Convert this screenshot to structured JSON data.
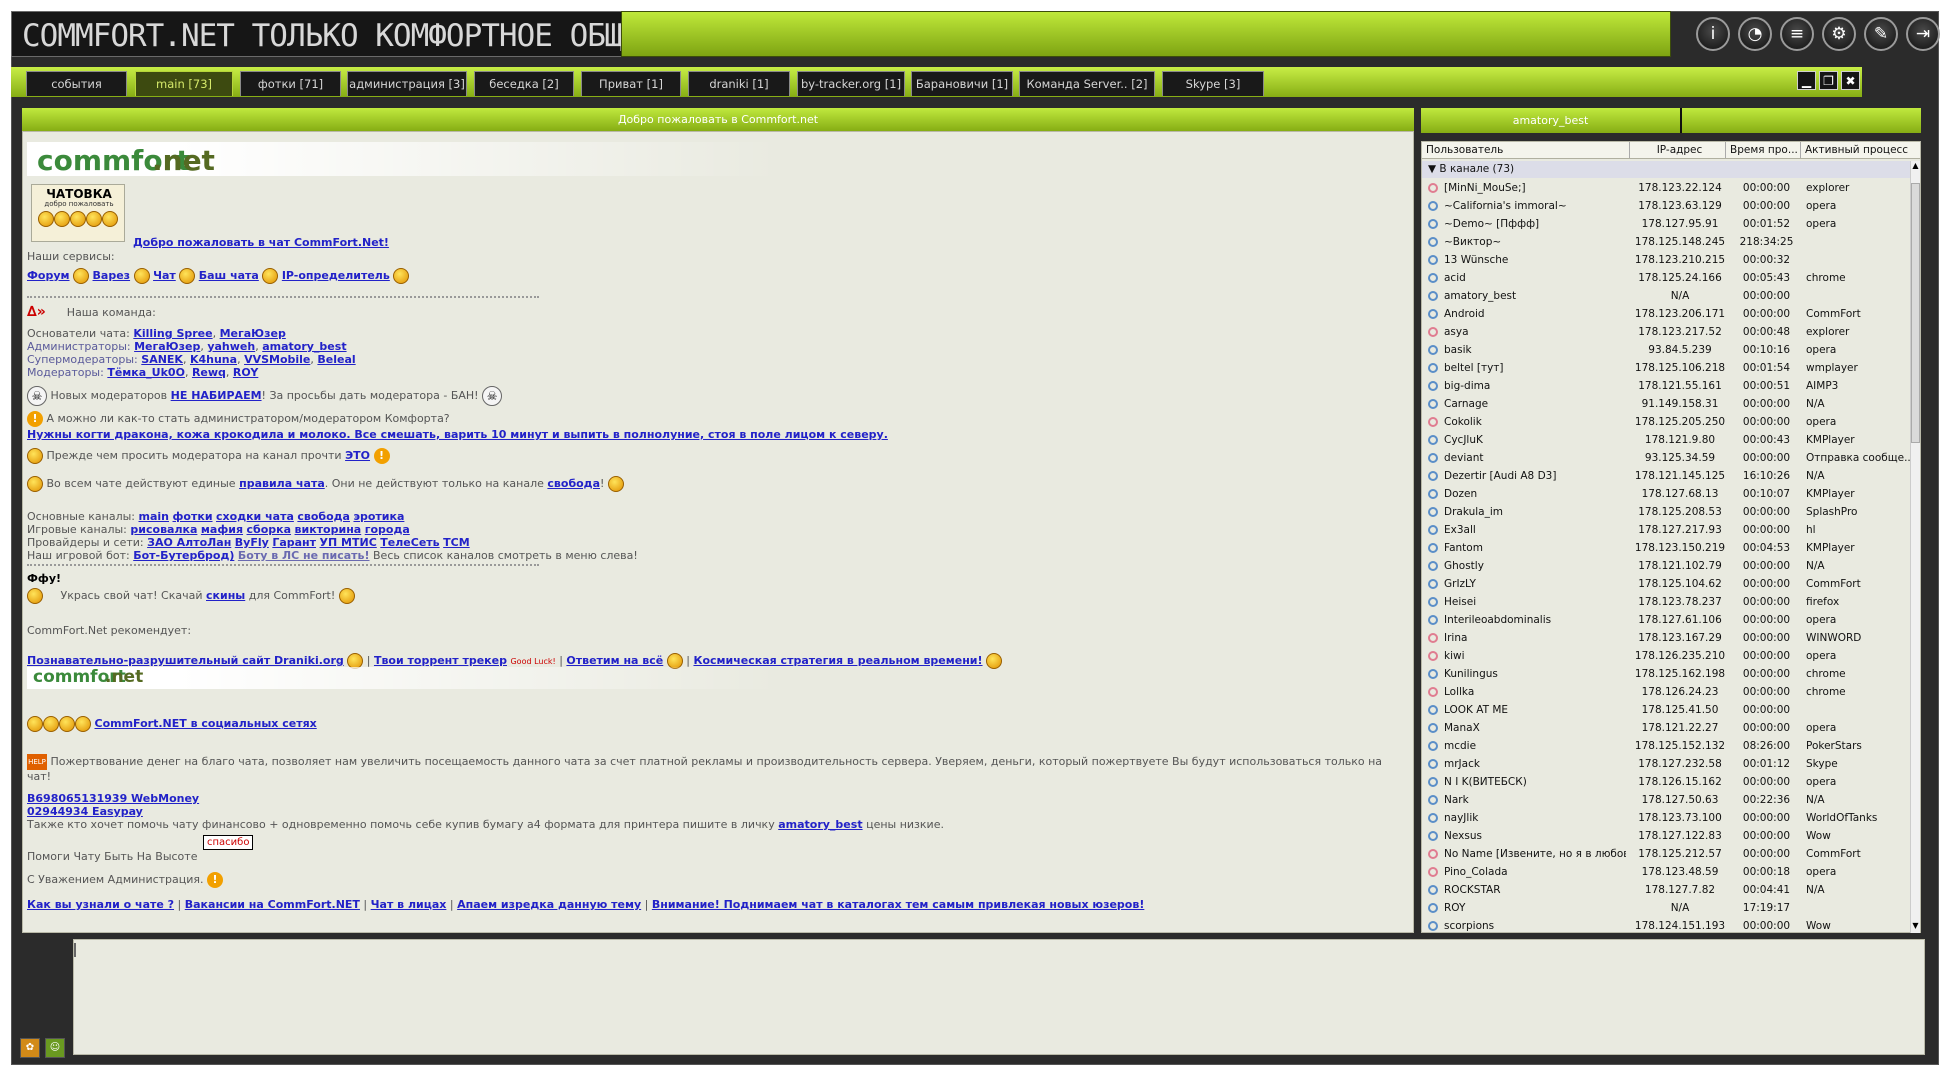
{
  "banner": {
    "title": "COMMFORT.NET ТОЛЬКО КОМФОРТНОЕ ОБЩЕНИЕ"
  },
  "top_icons": [
    {
      "name": "info-icon",
      "glyph": "i"
    },
    {
      "name": "chat-bubble-icon",
      "glyph": "◔"
    },
    {
      "name": "list-icon",
      "glyph": "≡"
    },
    {
      "name": "gear-icon",
      "glyph": "⚙"
    },
    {
      "name": "edit-icon",
      "glyph": "✎"
    },
    {
      "name": "exit-icon",
      "glyph": "⇥"
    }
  ],
  "tabs": [
    {
      "label": "события",
      "active": false
    },
    {
      "label": "main [73]",
      "active": true
    },
    {
      "label": "фотки [71]",
      "active": false
    },
    {
      "label": "администрация [3]",
      "active": false
    },
    {
      "label": "беседка [2]",
      "active": false
    },
    {
      "label": "Приват [1]",
      "active": false
    },
    {
      "label": "draniki [1]",
      "active": false
    },
    {
      "label": "by-tracker.org [1]",
      "active": false
    },
    {
      "label": "Барановичи [1]",
      "active": false
    },
    {
      "label": "Команда Server.. [2]",
      "active": false
    },
    {
      "label": "Skype [3]",
      "active": false
    }
  ],
  "window_buttons": {
    "minimize": "▁",
    "restore": "❐",
    "close": "✖"
  },
  "chat": {
    "header": "Добро пожаловать в Commfort.net",
    "logo_left": "commfort",
    "logo_right": ".net",
    "chatovka": {
      "title": "ЧАТОВКА",
      "subtitle": "добро пожаловать"
    },
    "welcome_link": "Добро пожаловать в чат CommFort.Net!",
    "services_label": "Наши сервисы:",
    "services": [
      "Форум",
      "Варез",
      "Чат",
      "Баш чата",
      "IP-определитель"
    ],
    "team_label": "Наша команда:",
    "founders_label": "Основатели чата:",
    "founders": [
      "Killing Spree",
      "МегаЮзер"
    ],
    "admins_label": "Администраторы:",
    "admins": [
      "МегаЮзер",
      "yahweh",
      "amatory_best"
    ],
    "supermods_label": "Супермодераторы:",
    "supermods": [
      "SANEK",
      "K4huna",
      "VVSMobile",
      "Beleal"
    ],
    "mods_label": "Модераторы:",
    "mods": [
      "Тёмка_Uk0O",
      "Rewq",
      "ROY"
    ],
    "new_mods_pre": "Новых модераторов",
    "new_mods_link": "НЕ НАБИРАЕМ",
    "new_mods_post": "! За просьбы дать модератора - БАН!",
    "admin_q": "А можно ли как-то стать администратором/модератором Комфорта?",
    "admin_a": "Нужны когти дракона, кожа крокодила и молоко. Все смешать, варить 10 минут и выпить в полнолуние, стоя в поле лицом к северу.",
    "before_ask_pre": "Прежде чем просить модератора на канал прочти",
    "before_ask_link": "ЭТО",
    "rules_pre": "Во всем чате действуют единые",
    "rules_link": "правила чата",
    "rules_mid": ". Они не действуют только на канале",
    "rules_link2": "свобода",
    "rules_post": "!",
    "main_channels_label": "Основные каналы:",
    "main_channels": [
      "main",
      "фотки",
      "сходки чата",
      "свобода",
      "эротика"
    ],
    "game_channels_label": "Игровые каналы:",
    "game_channels": [
      "рисовалка",
      "мафия",
      "сборка",
      "викторина",
      "города"
    ],
    "providers_label": "Провайдеры и сети:",
    "providers": [
      "ЗАО АлтоЛан",
      "ByFly",
      "Гарант",
      "УП МТИС",
      "ТелеСеть",
      "TCM"
    ],
    "bot_pre": "Наш игровой бот:",
    "bot_link": "Бот-Бутерброд)",
    "bot_link2": "Боту в ЛС не писать!",
    "bot_post": "Весь список каналов смотреть в меню слева!",
    "fufu": "Ффу!",
    "skins_pre": "Укрась свой чат! Скачай",
    "skins_link": "скины",
    "skins_post": "для CommFort!",
    "recommends": "CommFort.Net рекомендует:",
    "rec_links": [
      "Познавательно-разрушительный сайт Draniki.org",
      "Твои торрент трекер",
      "Ответим на всё",
      "Космическая стратегия в реальном времени!"
    ],
    "good_luck": "Good Luck!",
    "social_link": "CommFort.NET в социальных сетях",
    "help_badge": "HELP",
    "donate_text": "Пожертвование денег на благо чата, позволяет нам увеличить посещаемость данного чата за счет платной рекламы и производительность сервера. Уверяем, деньги, который пожертвуете Вы будут использоваться только на чат!",
    "webmoney": "B698065131939 WebMoney",
    "easypay": "02944934 Easypay",
    "a4_pre": "Также кто хочет помочь чату финансово + одновременно помочь себе купив бумагу а4 формата для принтера пишите в личку",
    "a4_link": "amatory_best",
    "a4_post": "цены низкие.",
    "help_chat": "Помоги Чату Быть На Высоте",
    "thanks_sign": "спасибо",
    "regards": "С Уважением Администрация.",
    "bottom_links": [
      "Как вы узнали о чате ?",
      "Вакансии на CommFort.NET",
      "Чат в лицах",
      "Апаем изредка данную тему",
      "Внимание! Поднимаем чат в каталогах тем самым привлекая новых юзеров!"
    ]
  },
  "userlist": {
    "header": "amatory_best",
    "columns": [
      "Пользователь",
      "IP-адрес",
      "Время про...",
      "Активный процесс"
    ],
    "group": "В канале (73)",
    "rows": [
      {
        "name": "[MinNi_MouSe;]",
        "ip": "178.123.22.124",
        "time": "00:00:00",
        "proc": "explorer",
        "g": "f"
      },
      {
        "name": "~California's immoral~",
        "ip": "178.123.63.129",
        "time": "00:00:00",
        "proc": "opera",
        "g": "m"
      },
      {
        "name": "~Demo~ [Пффф]",
        "ip": "178.127.95.91",
        "time": "00:01:52",
        "proc": "opera",
        "g": "m"
      },
      {
        "name": "~Виктор~",
        "ip": "178.125.148.245",
        "time": "218:34:25",
        "proc": "",
        "g": "m"
      },
      {
        "name": "13 Wünsche",
        "ip": "178.123.210.215",
        "time": "00:00:32",
        "proc": "",
        "g": "m"
      },
      {
        "name": "acid",
        "ip": "178.125.24.166",
        "time": "00:05:43",
        "proc": "chrome",
        "g": "m"
      },
      {
        "name": "amatory_best",
        "ip": "N/A",
        "time": "00:00:00",
        "proc": "",
        "g": "m"
      },
      {
        "name": "Android",
        "ip": "178.123.206.171",
        "time": "00:00:00",
        "proc": "CommFort",
        "g": "m"
      },
      {
        "name": "asya",
        "ip": "178.123.217.52",
        "time": "00:00:48",
        "proc": "explorer",
        "g": "f"
      },
      {
        "name": "basik",
        "ip": "93.84.5.239",
        "time": "00:10:16",
        "proc": "opera",
        "g": "m"
      },
      {
        "name": "beltel [тут]",
        "ip": "178.125.106.218",
        "time": "00:01:54",
        "proc": "wmplayer",
        "g": "m"
      },
      {
        "name": "big-dima",
        "ip": "178.121.55.161",
        "time": "00:00:51",
        "proc": "AIMP3",
        "g": "m"
      },
      {
        "name": "Carnage",
        "ip": "91.149.158.31",
        "time": "00:00:00",
        "proc": "N/A",
        "g": "m"
      },
      {
        "name": "Cokolik",
        "ip": "178.125.205.250",
        "time": "00:00:00",
        "proc": "opera",
        "g": "f"
      },
      {
        "name": "CycJluK",
        "ip": "178.121.9.80",
        "time": "00:00:43",
        "proc": "KMPlayer",
        "g": "m"
      },
      {
        "name": "deviant",
        "ip": "93.125.34.59",
        "time": "00:00:00",
        "proc": "Отправка сообще...",
        "g": "m"
      },
      {
        "name": "Dezertir [Audi A8 D3]",
        "ip": "178.121.145.125",
        "time": "16:10:26",
        "proc": "N/A",
        "g": "m"
      },
      {
        "name": "Dozen",
        "ip": "178.127.68.13",
        "time": "00:10:07",
        "proc": "KMPlayer",
        "g": "m"
      },
      {
        "name": "Drakula_im",
        "ip": "178.125.208.53",
        "time": "00:00:00",
        "proc": "SplashPro",
        "g": "m"
      },
      {
        "name": "Ex3all",
        "ip": "178.127.217.93",
        "time": "00:00:00",
        "proc": "hl",
        "g": "m"
      },
      {
        "name": "Fantom",
        "ip": "178.123.150.219",
        "time": "00:04:53",
        "proc": "KMPlayer",
        "g": "m"
      },
      {
        "name": "Ghostly",
        "ip": "178.121.102.79",
        "time": "00:00:00",
        "proc": "N/A",
        "g": "m"
      },
      {
        "name": "GrIzLY",
        "ip": "178.125.104.62",
        "time": "00:00:00",
        "proc": "CommFort",
        "g": "m"
      },
      {
        "name": "Heisei",
        "ip": "178.123.78.237",
        "time": "00:00:00",
        "proc": "firefox",
        "g": "m"
      },
      {
        "name": "Interileoabdominalis",
        "ip": "178.127.61.106",
        "time": "00:00:00",
        "proc": "opera",
        "g": "m"
      },
      {
        "name": "Irina",
        "ip": "178.123.167.29",
        "time": "00:00:00",
        "proc": "WINWORD",
        "g": "f"
      },
      {
        "name": "kiwi",
        "ip": "178.126.235.210",
        "time": "00:00:00",
        "proc": "opera",
        "g": "f"
      },
      {
        "name": "Kunilingus",
        "ip": "178.125.162.198",
        "time": "00:00:00",
        "proc": "chrome",
        "g": "m"
      },
      {
        "name": "Lollka",
        "ip": "178.126.24.23",
        "time": "00:00:00",
        "proc": "chrome",
        "g": "f"
      },
      {
        "name": "LOOK AT ME",
        "ip": "178.125.41.50",
        "time": "00:00:00",
        "proc": "",
        "g": "m"
      },
      {
        "name": "ManaX",
        "ip": "178.121.22.27",
        "time": "00:00:00",
        "proc": "opera",
        "g": "m"
      },
      {
        "name": "mcdie",
        "ip": "178.125.152.132",
        "time": "08:26:00",
        "proc": "PokerStars",
        "g": "m"
      },
      {
        "name": "mrJack",
        "ip": "178.127.232.58",
        "time": "00:01:12",
        "proc": "Skype",
        "g": "m"
      },
      {
        "name": "N I K(ВИТЕБСК)",
        "ip": "178.126.15.162",
        "time": "00:00:00",
        "proc": "opera",
        "g": "m"
      },
      {
        "name": "Nark",
        "ip": "178.127.50.63",
        "time": "00:22:36",
        "proc": "N/A",
        "g": "m"
      },
      {
        "name": "nayJlik",
        "ip": "178.123.73.100",
        "time": "00:00:00",
        "proc": "WorldOfTanks",
        "g": "m"
      },
      {
        "name": "Nexsus",
        "ip": "178.127.122.83",
        "time": "00:00:00",
        "proc": "Wow",
        "g": "m"
      },
      {
        "name": "No Name [Извените, но я в любов...",
        "ip": "178.125.212.57",
        "time": "00:00:00",
        "proc": "CommFort",
        "g": "f"
      },
      {
        "name": "Pino_Colada",
        "ip": "178.123.48.59",
        "time": "00:00:18",
        "proc": "opera",
        "g": "f"
      },
      {
        "name": "ROCKSTAR",
        "ip": "178.127.7.82",
        "time": "00:04:41",
        "proc": "N/A",
        "g": "m"
      },
      {
        "name": "ROY",
        "ip": "N/A",
        "time": "17:19:17",
        "proc": "",
        "g": "m"
      },
      {
        "name": "scorpions",
        "ip": "178.124.151.193",
        "time": "00:00:00",
        "proc": "Wow",
        "g": "m"
      }
    ]
  }
}
